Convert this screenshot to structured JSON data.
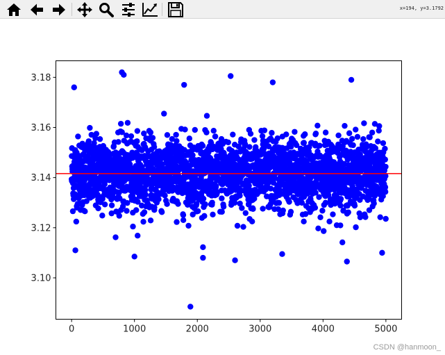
{
  "toolbar": {
    "buttons": [
      {
        "name": "home-icon",
        "icon": "home"
      },
      {
        "name": "back-icon",
        "icon": "arrow-left"
      },
      {
        "name": "forward-icon",
        "icon": "arrow-right"
      },
      {
        "name": "pan-icon",
        "icon": "move-arrows"
      },
      {
        "name": "zoom-icon",
        "icon": "magnifier"
      },
      {
        "name": "configure-subplots-icon",
        "icon": "sliders"
      },
      {
        "name": "edit-axis-icon",
        "icon": "line-chart"
      },
      {
        "name": "save-icon",
        "icon": "floppy-disk"
      }
    ],
    "coordinates": "x=194, y=3.1792"
  },
  "watermark": "CSDN @hanmoon_",
  "chart_data": {
    "type": "scatter",
    "title": "",
    "xlabel": "",
    "ylabel": "",
    "xlim": [
      -250,
      5250
    ],
    "ylim": [
      3.0835,
      3.1866
    ],
    "xticks": [
      0,
      1000,
      2000,
      3000,
      4000,
      5000
    ],
    "xtick_labels": [
      "0",
      "1000",
      "2000",
      "3000",
      "4000",
      "5000"
    ],
    "yticks": [
      3.1,
      3.12,
      3.14,
      3.16,
      3.18
    ],
    "ytick_labels": [
      "3.10",
      "3.12",
      "3.14",
      "3.16",
      "3.18"
    ],
    "grid": false,
    "series": [
      {
        "marker_color": "#0000ff",
        "n_points": 5000,
        "x_range": [
          0,
          5000
        ],
        "approx_mean": 3.1416,
        "approx_std": 0.0073,
        "notable_points": [
          {
            "x": 800,
            "y": 3.182
          },
          {
            "x": 830,
            "y": 3.181
          },
          {
            "x": 2530,
            "y": 3.1805
          },
          {
            "x": 4450,
            "y": 3.179
          },
          {
            "x": 40,
            "y": 3.176
          },
          {
            "x": 1790,
            "y": 3.177
          },
          {
            "x": 3200,
            "y": 3.178
          },
          {
            "x": 1890,
            "y": 3.0885
          },
          {
            "x": 4380,
            "y": 3.1065
          },
          {
            "x": 60,
            "y": 3.111
          },
          {
            "x": 1000,
            "y": 3.1085
          },
          {
            "x": 2090,
            "y": 3.108
          },
          {
            "x": 2600,
            "y": 3.107
          },
          {
            "x": 3350,
            "y": 3.1095
          },
          {
            "x": 4940,
            "y": 3.11
          }
        ]
      }
    ],
    "reference_line": {
      "y": 3.1416,
      "color": "#ff0000"
    }
  }
}
